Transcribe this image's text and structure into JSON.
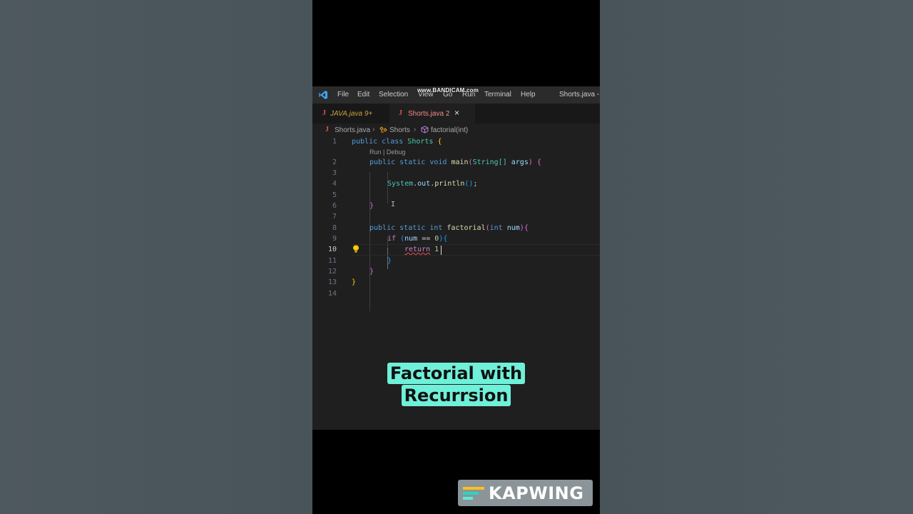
{
  "watermark": "www.BANDICAM.com",
  "menu": [
    "File",
    "Edit",
    "Selection",
    "View",
    "Go",
    "Run",
    "Terminal",
    "Help"
  ],
  "window_title": "Shorts.java - ...",
  "tabs": [
    {
      "label": "JAVA.java",
      "badge": "9+",
      "icon": "J"
    },
    {
      "label": "Shorts.java",
      "badge": "2",
      "icon": "J",
      "close": "×"
    }
  ],
  "breadcrumb": {
    "file": "Shorts.java",
    "class": "Shorts",
    "method": "factorial(int)"
  },
  "codelens": "Run | Debug",
  "code": {
    "line_numbers": [
      "1",
      "2",
      "3",
      "4",
      "5",
      "6",
      "7",
      "8",
      "9",
      "10",
      "11",
      "12",
      "13",
      "14"
    ],
    "l1": {
      "kw1": "public",
      "kw2": "class",
      "name": "Shorts",
      "brace": "{"
    },
    "l2": {
      "kw1": "public",
      "kw2": "static",
      "kw3": "void",
      "fn": "main",
      "open": "(",
      "type": "String[]",
      "arg": "args",
      "close": ")",
      "brace": "{"
    },
    "l4": {
      "type": "System",
      "dot1": ".",
      "field": "out",
      "dot2": ".",
      "fn": "println",
      "paren": "()",
      "semi": ";"
    },
    "l6": {
      "brace": "}"
    },
    "l8": {
      "kw1": "public",
      "kw2": "static",
      "kw3": "int",
      "fn": "factorial",
      "open": "(",
      "kw4": "int",
      "arg": "num",
      "close": ")",
      "brace": "{"
    },
    "l9": {
      "kw": "if",
      "open": "(",
      "var": "num",
      "op": "==",
      "num": "0",
      "close": ")",
      "brace": "{"
    },
    "l10": {
      "kw": "return",
      "num": "1"
    },
    "l11": {
      "brace": "}"
    },
    "l12": {
      "brace": "}"
    },
    "l13": {
      "brace": "}"
    }
  },
  "caption": {
    "line1": "Factorial with",
    "line2": "Recurrsion"
  },
  "kapwing": "KAPWING",
  "colors": {
    "caption_bg": "#6ff0d8",
    "editor_bg": "#1f1f1f",
    "keyword": "#569cd6",
    "type": "#4ec9b0",
    "function": "#dcdcaa"
  }
}
